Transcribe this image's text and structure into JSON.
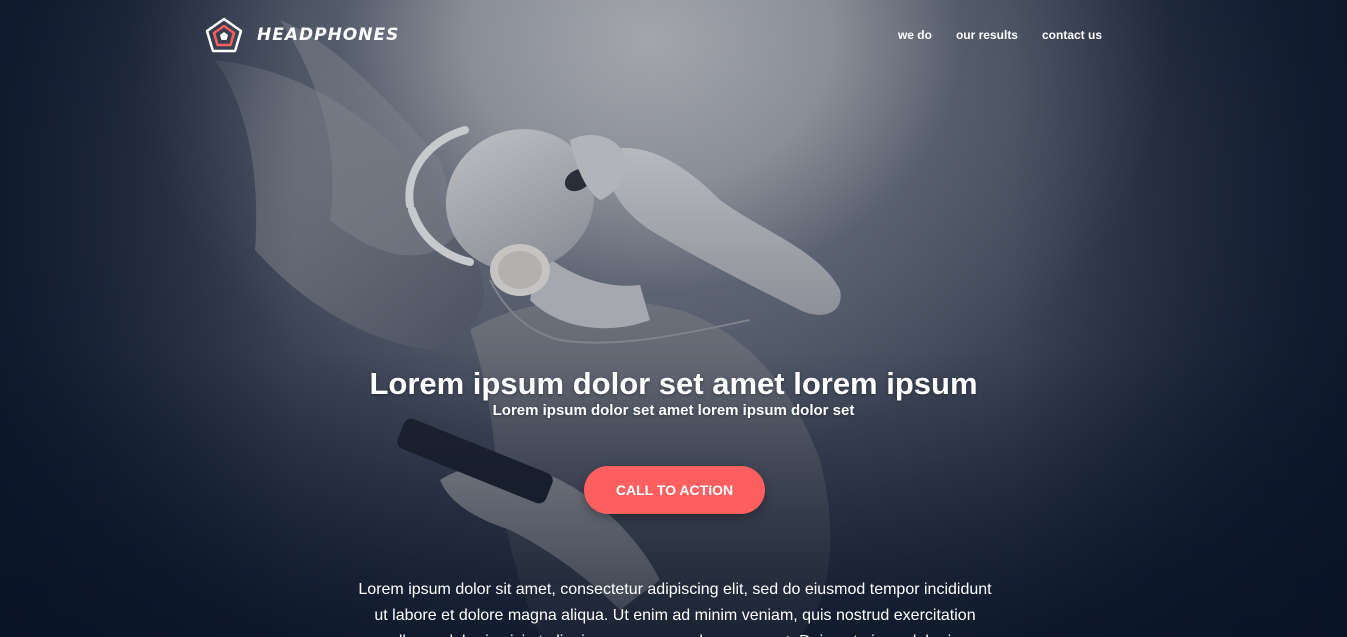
{
  "brand": {
    "name": "HEADPHONES",
    "logo_icon": "pentagon-logo-icon",
    "logo_accent": "#ff5f5f"
  },
  "nav": {
    "items": [
      {
        "label": "we do"
      },
      {
        "label": "our results"
      },
      {
        "label": "contact us"
      }
    ]
  },
  "hero": {
    "headline": "Lorem ipsum dolor set amet lorem ipsum",
    "subheadline": "Lorem ipsum dolor set amet lorem ipsum dolor set",
    "cta_label": "CALL TO ACTION",
    "cta_color": "#ff5f5f",
    "body": "Lorem ipsum dolor sit amet, consectetur adipiscing elit, sed do eiusmod tempor incididunt ut labore et dolore magna aliqua. Ut enim ad minim veniam, quis nostrud exercitation ullamco laboris nisi ut aliquip ex ea commodo consequat. Duis aute irure dolor in"
  }
}
